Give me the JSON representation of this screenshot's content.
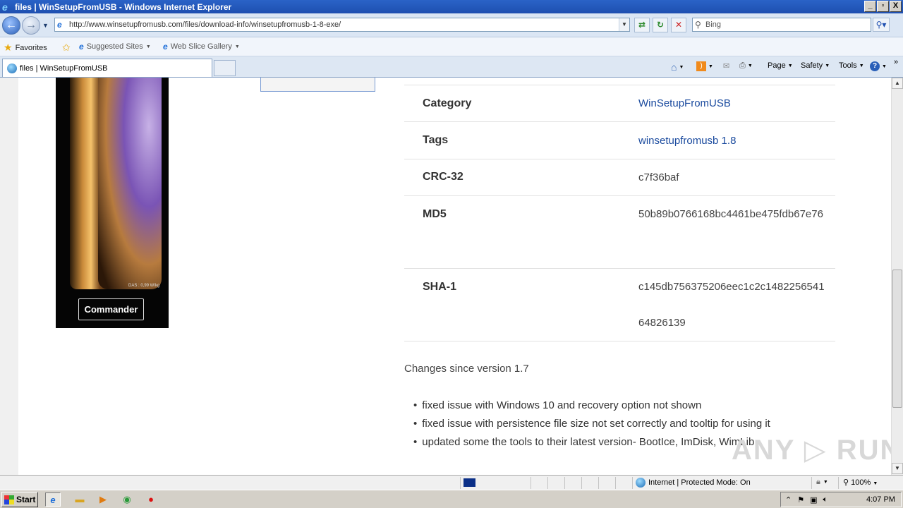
{
  "window": {
    "title": "files | WinSetupFromUSB - Windows Internet Explorer",
    "min": "_",
    "max": "▫",
    "close": "X"
  },
  "address": {
    "url": "http://www.winsetupfromusb.com/files/download-info/winsetupfromusb-1-8-exe/",
    "search_placeholder": "Bing"
  },
  "favorites_bar": {
    "favorites": "Favorites",
    "suggested": "Suggested Sites",
    "webslice": "Web Slice Gallery"
  },
  "tab": {
    "title": "files | WinSetupFromUSB"
  },
  "command_bar": {
    "page": "Page",
    "safety": "Safety",
    "tools": "Tools"
  },
  "ad": {
    "das_text": "DAS : 0,99 W/kg",
    "cta": "Commander"
  },
  "info_table": [
    {
      "label": "Category",
      "value": "WinSetupFromUSB",
      "link": true
    },
    {
      "label": "Tags",
      "value": "winsetupfromusb 1.8",
      "link": true
    },
    {
      "label": "CRC-32",
      "value": "c7f36baf",
      "link": false
    },
    {
      "label": "MD5",
      "value": "50b89b0766168bc4461be475fdb67e76",
      "link": false
    },
    {
      "label": "SHA-1",
      "value": "c145db756375206eec1c2c148225654164826139",
      "link": false
    }
  ],
  "changes_heading": "Changes since version 1.7",
  "changes": [
    "fixed issue with Windows 10 and recovery option not shown",
    "fixed issue with persistence file size not set correctly and tooltip for using it",
    "updated some the tools to their latest version- BootIce, ImDisk, WimLib"
  ],
  "watermark": "ANY ▷ RUN",
  "status": {
    "zone": "Internet | Protected Mode: On",
    "zoom": "100%"
  },
  "taskbar": {
    "start": "Start",
    "clock": "4:07 PM"
  },
  "colors": {
    "link": "#1a4a9e",
    "titlebar": "#2a63c7"
  }
}
